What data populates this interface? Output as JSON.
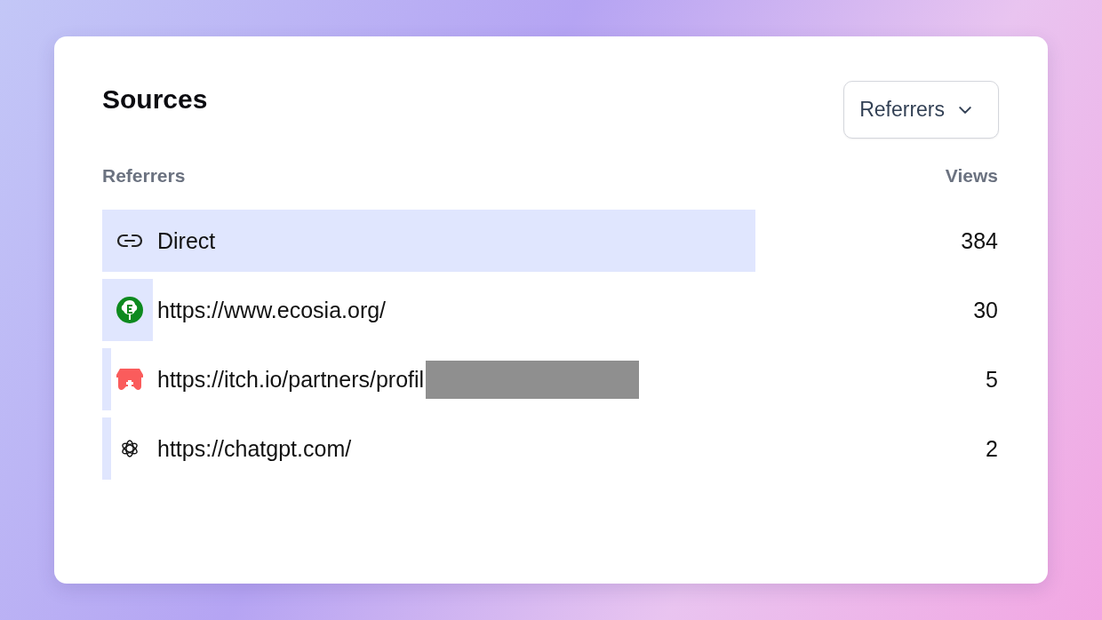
{
  "card": {
    "title": "Sources",
    "dropdown": {
      "label": "Referrers"
    }
  },
  "table": {
    "columns": [
      "Referrers",
      "Views"
    ],
    "rows": [
      {
        "kind": "link",
        "label": "Direct",
        "views": "384",
        "redacted": false
      },
      {
        "kind": "ecosia",
        "label": "https://www.ecosia.org/",
        "views": "30",
        "redacted": false
      },
      {
        "kind": "itch",
        "label": "https://itch.io/partners/profil",
        "views": "5",
        "redacted": true
      },
      {
        "kind": "chatgpt",
        "label": "https://chatgpt.com/",
        "views": "2",
        "redacted": false
      }
    ]
  }
}
